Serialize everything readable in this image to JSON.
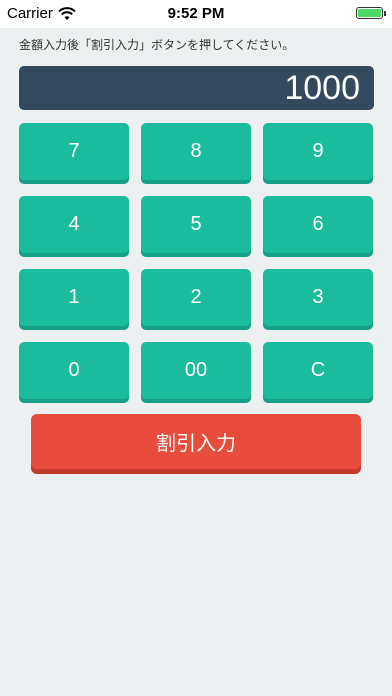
{
  "status_bar": {
    "carrier": "Carrier",
    "time": "9:52 PM"
  },
  "instruction": "金額入力後「割引入力」ボタンを押してください。",
  "display": {
    "value": "1000"
  },
  "keypad": {
    "row1": [
      "7",
      "8",
      "9"
    ],
    "row2": [
      "4",
      "5",
      "6"
    ],
    "row3": [
      "1",
      "2",
      "3"
    ],
    "row4": [
      "0",
      "00",
      "C"
    ]
  },
  "discount_button": {
    "label": "割引入力"
  },
  "colors": {
    "background": "#ecf0f1",
    "display_bg": "#34495e",
    "key_bg": "#1abc9c",
    "discount_bg": "#e74c3c"
  }
}
